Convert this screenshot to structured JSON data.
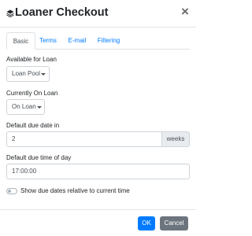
{
  "modal": {
    "title": "Loaner Checkout",
    "title_icon": "layers-icon",
    "close_label": "×"
  },
  "tabs": [
    {
      "label": "Basic",
      "active": true
    },
    {
      "label": "Terms",
      "active": false
    },
    {
      "label": "E-mail",
      "active": false
    },
    {
      "label": "Filtering",
      "active": false
    }
  ],
  "form": {
    "available_label": "Available for Loan",
    "available_value": "Loan Pool",
    "on_loan_label": "Currently On Loan",
    "on_loan_value": "On Loan",
    "due_date_label": "Default due date in",
    "due_date_value": "2",
    "due_date_unit": "weeks",
    "due_time_label": "Default due time of day",
    "due_time_value": "17:00:00",
    "relative_toggle_label": "Show due dates relative to current time",
    "relative_toggle_on": false
  },
  "footer": {
    "ok_label": "OK",
    "cancel_label": "Cancel"
  },
  "colors": {
    "primary": "#007bff",
    "secondary": "#6c757d"
  }
}
